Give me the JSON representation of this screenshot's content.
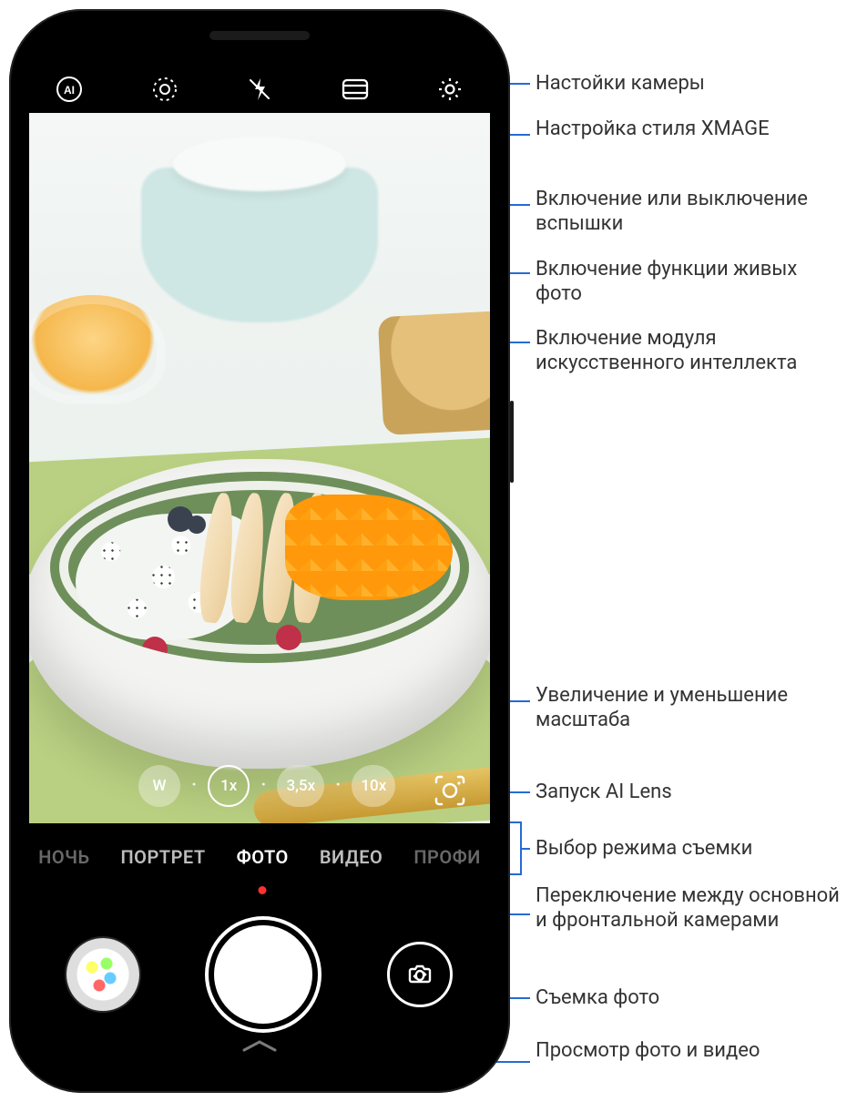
{
  "topbar": {
    "ai_icon": "AI",
    "live_icon": "live-photo",
    "flash_icon": "flash-off",
    "style_icon": "xmage-style",
    "settings_icon": "settings"
  },
  "zoom": {
    "wide": "W",
    "z1": "1x",
    "z2": "3,5x",
    "z3": "10x"
  },
  "modes": {
    "night": "НОЧЬ",
    "portrait": "ПОРТРЕТ",
    "photo": "ФОТО",
    "video": "ВИДЕО",
    "pro": "ПРОФИ"
  },
  "callouts": {
    "settings": "Настойки камеры",
    "style": "Настройка стиля XMAGE",
    "flash": "Включение или выключение вспышки",
    "live": "Включение функции живых фото",
    "ai": "Включение модуля искусственного интеллекта",
    "zoom": "Увеличение и уменьшение масштаба",
    "ailens": "Запуск AI Lens",
    "modes": "Выбор режима съемки",
    "flip": "Переключение между основной и фронтальной камерами",
    "shutter": "Съемка фото",
    "gallery": "Просмотр фото и видео"
  }
}
